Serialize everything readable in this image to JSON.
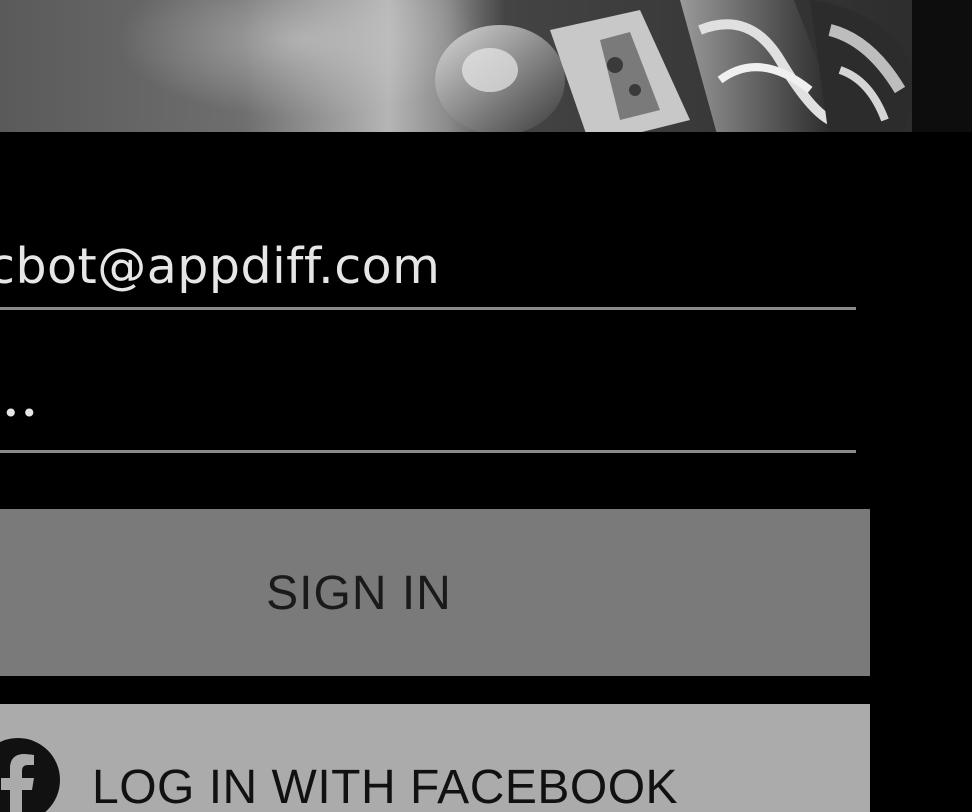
{
  "hero": {
    "image_icon": "stuffed-toy-photo"
  },
  "form": {
    "email": {
      "value": "cbot@appdiff.com"
    },
    "password": {
      "value": "•••"
    }
  },
  "buttons": {
    "sign_in_label": "SIGN IN",
    "facebook_label": "LOG IN WITH FACEBOOK",
    "facebook_icon": "facebook-icon"
  },
  "colors": {
    "background": "#000000",
    "sign_in_button": "#7a7a7a",
    "facebook_button": "#ababab",
    "input_underline": "#8a8a8a",
    "input_text": "#e6e6e6"
  }
}
